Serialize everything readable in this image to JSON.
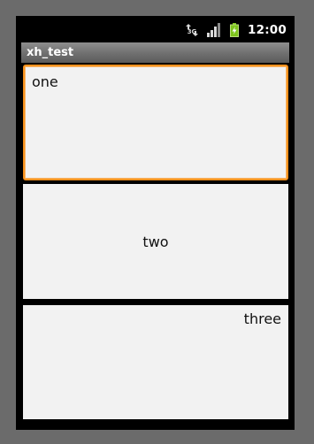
{
  "status_bar": {
    "network_icon": "data-network-3g-icon",
    "signal_icon": "signal-strength-icon",
    "battery_icon": "battery-charging-icon",
    "time": "12:00",
    "colors": {
      "battery": "#7ec51c",
      "icons": "#d9d9d9"
    }
  },
  "title_bar": {
    "title": "xh_test"
  },
  "panels": [
    {
      "label": "one",
      "align": "top-left",
      "focused": true
    },
    {
      "label": "two",
      "align": "center",
      "focused": false
    },
    {
      "label": "three",
      "align": "top-right",
      "focused": false
    }
  ],
  "colors": {
    "focus_border": "#f7921e",
    "panel_background": "#f2f2f2",
    "screen_background": "#000000",
    "frame_background": "#6b6b6b"
  }
}
